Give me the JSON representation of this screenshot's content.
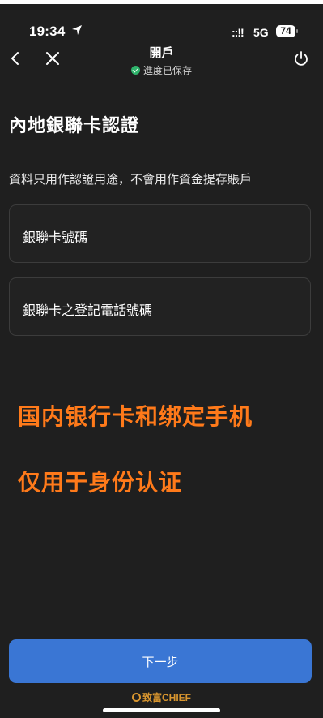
{
  "status_bar": {
    "time": "19:34",
    "signal": "::!!",
    "network": "5G",
    "battery": "74"
  },
  "nav": {
    "title": "開戶",
    "subtitle": "進度已保存"
  },
  "page": {
    "title": "內地銀聯卡認證",
    "subtitle": "資料只用作認證用途，不會用作資金提存賬戶"
  },
  "fields": {
    "card_number_placeholder": "銀聯卡號碼",
    "phone_placeholder": "銀聯卡之登記電話號碼"
  },
  "annotations": {
    "line1": "国内银行卡和绑定手机",
    "line2": "仅用于身份认证"
  },
  "button": {
    "next_label": "下一步"
  },
  "brand": {
    "text": "致富CHIEF"
  },
  "colors": {
    "background": "#1f1f1f",
    "accent_button": "#3a76d4",
    "annotation": "#ff7a1a",
    "saved_check": "#2fb36b",
    "brand": "#d9962f"
  }
}
